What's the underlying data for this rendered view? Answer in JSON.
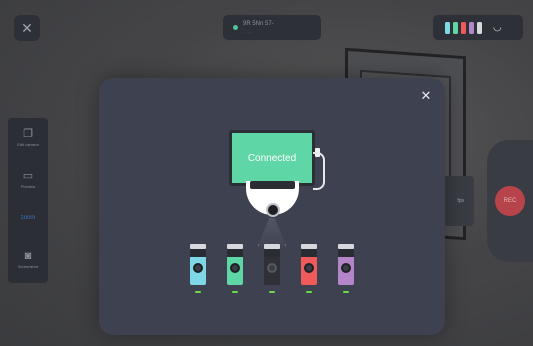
{
  "status": {
    "title": "9R 5Nn 57-",
    "subtitle": "- - - -"
  },
  "toolbar_left": {
    "items": [
      {
        "label": "Edit camera",
        "icon": "copy-icon"
      },
      {
        "label": "Preview",
        "icon": "monitor-icon"
      },
      {
        "label": "zoom",
        "icon": ""
      },
      {
        "label": "Screenshot",
        "icon": "camera-icon"
      }
    ]
  },
  "right_panel": {
    "record_label": "REC",
    "card_label": "fps"
  },
  "modal": {
    "screen_text": "Connected"
  },
  "colors": {
    "screen": "#5fd6a6",
    "device_colors": [
      "#7fd8e6",
      "#5fd6a6",
      "#2e3036",
      "#ef5a5a",
      "#b486c9"
    ],
    "led": "#6fd84a",
    "record": "#b8444b"
  }
}
